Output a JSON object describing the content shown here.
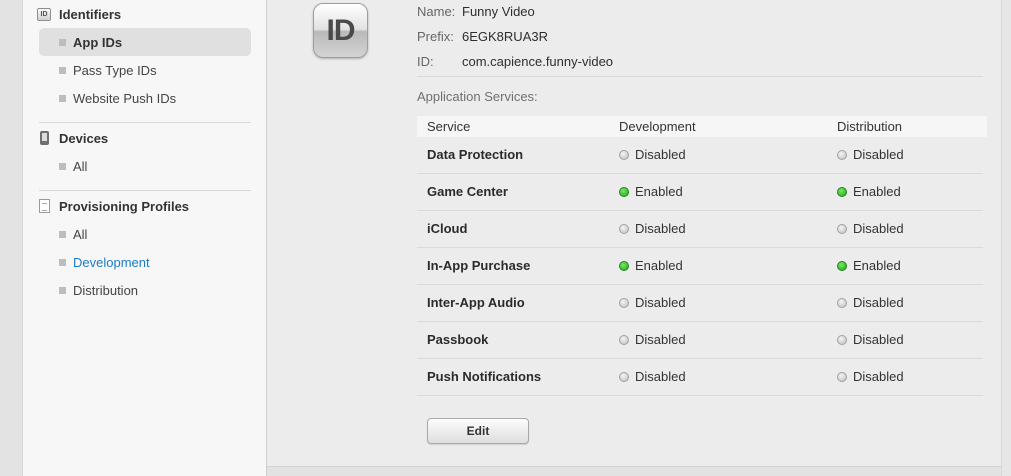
{
  "sidebar": {
    "identifiers": {
      "title": "Identifiers",
      "items": [
        {
          "label": "App IDs"
        },
        {
          "label": "Pass Type IDs"
        },
        {
          "label": "Website Push IDs"
        }
      ]
    },
    "devices": {
      "title": "Devices",
      "items": [
        {
          "label": "All"
        }
      ]
    },
    "profiles": {
      "title": "Provisioning Profiles",
      "items": [
        {
          "label": "All"
        },
        {
          "label": "Development"
        },
        {
          "label": "Distribution"
        }
      ]
    }
  },
  "app": {
    "icon_text": "ID",
    "name_label": "Name:",
    "name_value": "Funny Video",
    "prefix_label": "Prefix:",
    "prefix_value": "6EGK8RUA3R",
    "id_label": "ID:",
    "id_value": "com.capience.funny-video"
  },
  "services": {
    "title": "Application Services:",
    "headers": {
      "service": "Service",
      "development": "Development",
      "distribution": "Distribution"
    },
    "rows": [
      {
        "name": "Data Protection",
        "dev": "Disabled",
        "dist": "Disabled",
        "dev_on": false,
        "dist_on": false
      },
      {
        "name": "Game Center",
        "dev": "Enabled",
        "dist": "Enabled",
        "dev_on": true,
        "dist_on": true
      },
      {
        "name": "iCloud",
        "dev": "Disabled",
        "dist": "Disabled",
        "dev_on": false,
        "dist_on": false
      },
      {
        "name": "In-App Purchase",
        "dev": "Enabled",
        "dist": "Enabled",
        "dev_on": true,
        "dist_on": true
      },
      {
        "name": "Inter-App Audio",
        "dev": "Disabled",
        "dist": "Disabled",
        "dev_on": false,
        "dist_on": false
      },
      {
        "name": "Passbook",
        "dev": "Disabled",
        "dist": "Disabled",
        "dev_on": false,
        "dist_on": false
      },
      {
        "name": "Push Notifications",
        "dev": "Disabled",
        "dist": "Disabled",
        "dev_on": false,
        "dist_on": false
      }
    ]
  },
  "edit_button": {
    "label": "Edit"
  },
  "colors": {
    "enabled": "#22a51a",
    "disabled": "#bdbdbd",
    "link": "#1d7dc1"
  }
}
